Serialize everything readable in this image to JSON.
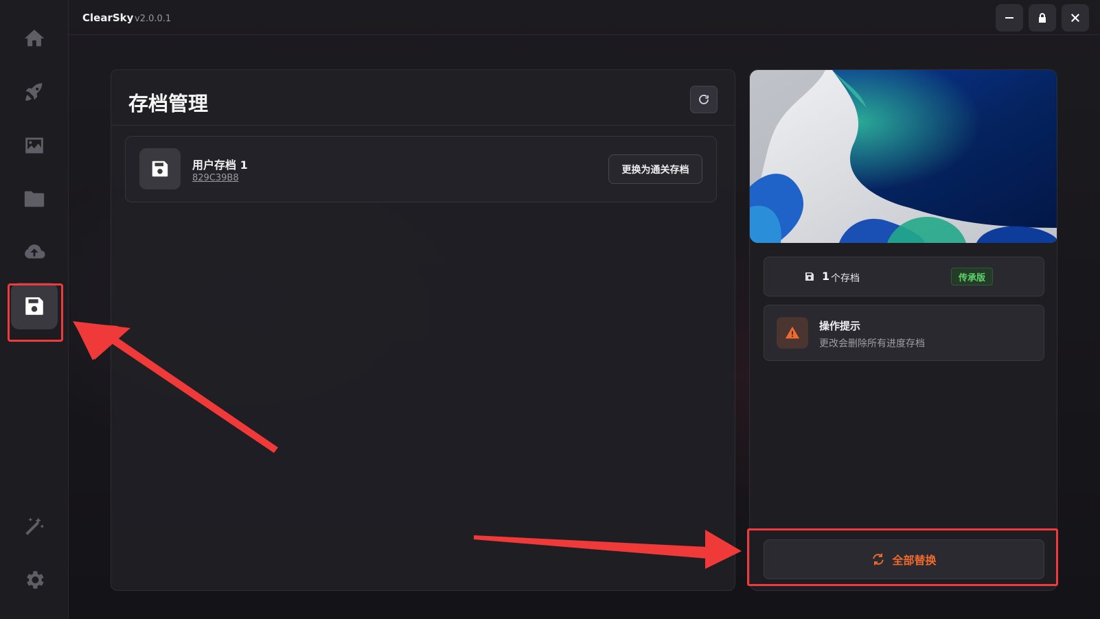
{
  "titlebar": {
    "app_name": "ClearSky",
    "version": "v2.0.0.1",
    "buttons": [
      "minimize-icon",
      "lock-icon",
      "close-icon"
    ]
  },
  "sidebar": {
    "items": [
      {
        "icon": "home-icon"
      },
      {
        "icon": "rocket-icon"
      },
      {
        "icon": "image-icon"
      },
      {
        "icon": "folder-icon"
      },
      {
        "icon": "cloud-upload-icon"
      },
      {
        "icon": "save-icon",
        "active": true
      },
      {
        "icon": "magic-wand-icon"
      },
      {
        "icon": "gear-icon"
      }
    ]
  },
  "main": {
    "title": "存档管理",
    "saves": [
      {
        "name": "用户存档 1",
        "id": "829C39B8",
        "action_label": "更换为通关存档"
      }
    ]
  },
  "right_panel": {
    "save_count": "1",
    "save_count_label": "个存档",
    "edition_badge": "传承版",
    "tip_title": "操作提示",
    "tip_text": "更改会删除所有进度存档",
    "replace_all_label": "全部替换"
  },
  "colors": {
    "accent_orange": "#ee6a2f",
    "badge_green": "#5ed36b",
    "highlight_red": "#ef3b3b"
  }
}
